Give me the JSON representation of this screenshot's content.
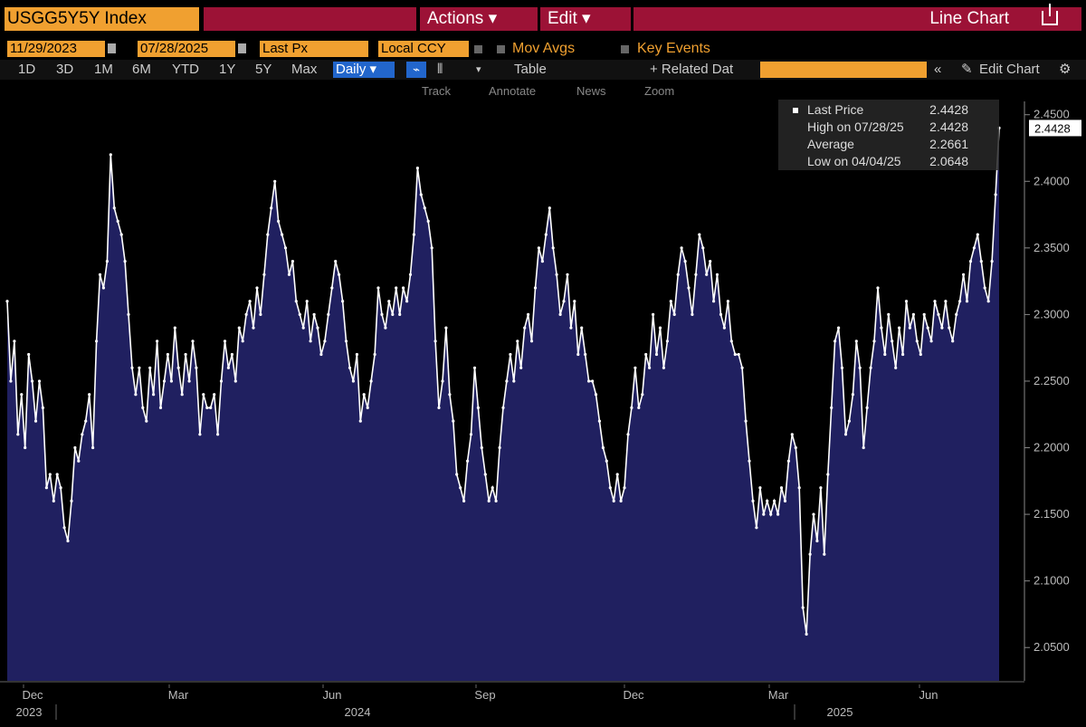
{
  "toolbar": {
    "ticker": "USGG5Y5Y Index",
    "actions_label": "Actions",
    "edit_label": "Edit",
    "chart_label": "Line Chart",
    "start_date": "11/29/2023",
    "end_date": "07/28/2025",
    "field": "Last Px",
    "currency": "Local CCY",
    "mov_avgs_label": "Mov Avgs",
    "key_events_label": "Key Events",
    "periods": [
      "1D",
      "3D",
      "1M",
      "6M",
      "YTD",
      "1Y",
      "5Y",
      "Max"
    ],
    "frequency": "Daily",
    "table_label": "Table",
    "related_label": "+ Related Dat",
    "edit_chart_label": "Edit Chart",
    "sub_tools": [
      "Track",
      "Annotate",
      "News",
      "Zoom"
    ]
  },
  "legend": {
    "rows": [
      {
        "label": "Last Price",
        "value": "2.4428"
      },
      {
        "label": "High on 07/28/25",
        "value": "2.4428"
      },
      {
        "label": "Average",
        "value": "2.2661"
      },
      {
        "label": "Low on 04/04/25",
        "value": "2.0648"
      }
    ]
  },
  "colors": {
    "accent": "#f0a030",
    "header_red": "#9c1236",
    "area_fill": "#202060",
    "line": "#ffffff"
  },
  "chart_data": {
    "type": "area",
    "title": "",
    "xlabel": "",
    "ylabel": "",
    "ylim": [
      2.025,
      2.46
    ],
    "y_ticks": [
      "2.4000",
      "2.3500",
      "2.3000",
      "2.2500",
      "2.2000",
      "2.1500",
      "2.1000",
      "2.0500"
    ],
    "y_top_tick_partial": "2.4500",
    "last_value_label": "2.4428",
    "x_ticks": [
      "Dec",
      "Mar",
      "Jun",
      "Sep",
      "Dec",
      "Mar",
      "Jun"
    ],
    "x_years": [
      "2023",
      "2024",
      "2025"
    ],
    "grid": false,
    "legend_position": "top-right",
    "series": [
      {
        "values": [
          2.31,
          2.25,
          2.28,
          2.21,
          2.24,
          2.2,
          2.27,
          2.25,
          2.22,
          2.25,
          2.23,
          2.17,
          2.18,
          2.16,
          2.18,
          2.17,
          2.14,
          2.13,
          2.16,
          2.2,
          2.19,
          2.21,
          2.22,
          2.24,
          2.2,
          2.28,
          2.33,
          2.32,
          2.34,
          2.42,
          2.38,
          2.37,
          2.36,
          2.34,
          2.3,
          2.26,
          2.24,
          2.26,
          2.23,
          2.22,
          2.26,
          2.24,
          2.28,
          2.23,
          2.25,
          2.27,
          2.25,
          2.29,
          2.26,
          2.24,
          2.27,
          2.25,
          2.28,
          2.26,
          2.21,
          2.24,
          2.23,
          2.23,
          2.24,
          2.21,
          2.25,
          2.28,
          2.26,
          2.27,
          2.25,
          2.29,
          2.28,
          2.3,
          2.31,
          2.29,
          2.32,
          2.3,
          2.33,
          2.36,
          2.38,
          2.4,
          2.37,
          2.36,
          2.35,
          2.33,
          2.34,
          2.31,
          2.3,
          2.29,
          2.31,
          2.28,
          2.3,
          2.29,
          2.27,
          2.28,
          2.3,
          2.32,
          2.34,
          2.33,
          2.31,
          2.28,
          2.26,
          2.25,
          2.27,
          2.22,
          2.24,
          2.23,
          2.25,
          2.27,
          2.32,
          2.3,
          2.29,
          2.31,
          2.3,
          2.32,
          2.3,
          2.32,
          2.31,
          2.33,
          2.36,
          2.41,
          2.39,
          2.38,
          2.37,
          2.35,
          2.28,
          2.23,
          2.25,
          2.29,
          2.24,
          2.22,
          2.18,
          2.17,
          2.16,
          2.19,
          2.21,
          2.26,
          2.23,
          2.2,
          2.18,
          2.16,
          2.17,
          2.16,
          2.2,
          2.23,
          2.25,
          2.27,
          2.25,
          2.28,
          2.26,
          2.29,
          2.3,
          2.28,
          2.32,
          2.35,
          2.34,
          2.36,
          2.38,
          2.35,
          2.33,
          2.3,
          2.31,
          2.33,
          2.29,
          2.31,
          2.27,
          2.29,
          2.27,
          2.25,
          2.25,
          2.24,
          2.22,
          2.2,
          2.19,
          2.17,
          2.16,
          2.18,
          2.16,
          2.17,
          2.21,
          2.23,
          2.26,
          2.23,
          2.24,
          2.27,
          2.26,
          2.3,
          2.27,
          2.29,
          2.26,
          2.28,
          2.31,
          2.3,
          2.33,
          2.35,
          2.34,
          2.32,
          2.3,
          2.33,
          2.36,
          2.35,
          2.33,
          2.34,
          2.31,
          2.33,
          2.3,
          2.29,
          2.31,
          2.28,
          2.27,
          2.27,
          2.26,
          2.22,
          2.19,
          2.16,
          2.14,
          2.17,
          2.15,
          2.16,
          2.15,
          2.16,
          2.15,
          2.17,
          2.16,
          2.19,
          2.21,
          2.2,
          2.17,
          2.08,
          2.06,
          2.12,
          2.15,
          2.13,
          2.17,
          2.12,
          2.18,
          2.23,
          2.28,
          2.29,
          2.26,
          2.21,
          2.22,
          2.24,
          2.28,
          2.26,
          2.2,
          2.23,
          2.26,
          2.28,
          2.32,
          2.29,
          2.27,
          2.3,
          2.28,
          2.26,
          2.29,
          2.27,
          2.31,
          2.29,
          2.3,
          2.28,
          2.27,
          2.3,
          2.29,
          2.28,
          2.31,
          2.3,
          2.29,
          2.31,
          2.29,
          2.28,
          2.3,
          2.31,
          2.33,
          2.31,
          2.34,
          2.35,
          2.36,
          2.34,
          2.32,
          2.31,
          2.34,
          2.39,
          2.44
        ]
      }
    ]
  }
}
